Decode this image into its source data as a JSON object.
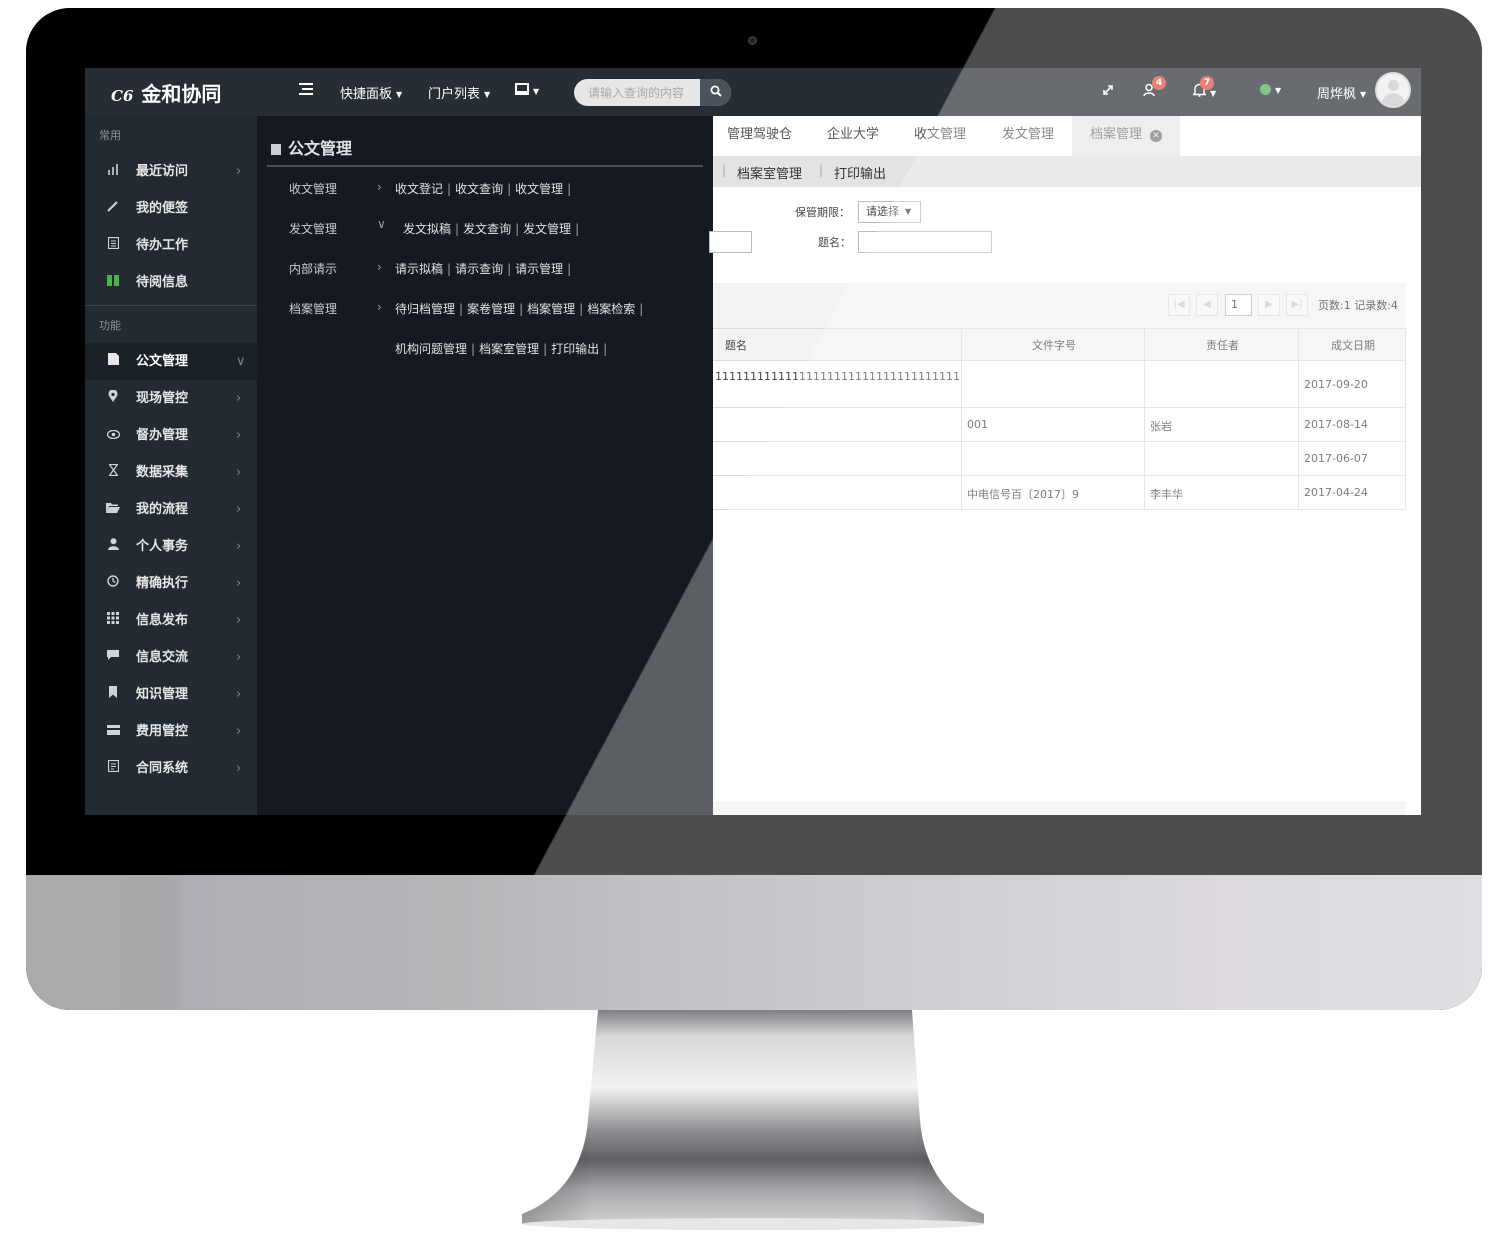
{
  "topbar": {
    "logo_mark": "C6",
    "logo_text": "金和协同",
    "menu_icon": "menu-lines-icon",
    "quick_panel": "快捷面板",
    "portal_list": "门户列表",
    "desktop_icon": "monitor-icon",
    "search": {
      "placeholder": "请输入查询的内容"
    },
    "user_badge": "4",
    "bell_badge": "7",
    "status_color": "#4caf50",
    "user_name": "周烨枫"
  },
  "sidebar": {
    "section_common": "常用",
    "common_items": [
      {
        "label": "最近访问",
        "icon": "bar-chart-icon"
      },
      {
        "label": "我的便签",
        "icon": "pencil-icon"
      },
      {
        "label": "待办工作",
        "icon": "document-icon"
      },
      {
        "label": "待阅信息",
        "icon": "columns-icon"
      }
    ],
    "section_function": "功能",
    "function_items": [
      {
        "label": "公文管理",
        "icon": "file-icon"
      },
      {
        "label": "现场管控",
        "icon": "map-pin-icon"
      },
      {
        "label": "督办管理",
        "icon": "eye-icon"
      },
      {
        "label": "数据采集",
        "icon": "hourglass-icon"
      },
      {
        "label": "我的流程",
        "icon": "folder-open-icon"
      },
      {
        "label": "个人事务",
        "icon": "user-icon"
      },
      {
        "label": "精确执行",
        "icon": "clock-icon"
      },
      {
        "label": "信息发布",
        "icon": "grid-icon"
      },
      {
        "label": "信息交流",
        "icon": "chat-icon"
      },
      {
        "label": "知识管理",
        "icon": "bookmark-icon"
      },
      {
        "label": "费用管控",
        "icon": "card-icon"
      },
      {
        "label": "合同系统",
        "icon": "contract-icon"
      }
    ]
  },
  "mega": {
    "title": "公文管理",
    "rows": [
      {
        "category": "收文管理",
        "links": [
          "收文登记",
          "收文查询",
          "收文管理"
        ]
      },
      {
        "category": "发文管理",
        "links": [
          "发文拟稿",
          "发文查询",
          "发文管理"
        ]
      },
      {
        "category": "内部请示",
        "links": [
          "请示拟稿",
          "请示查询",
          "请示管理"
        ]
      },
      {
        "category": "档案管理",
        "links": [
          "待归档管理",
          "案卷管理",
          "档案管理",
          "档案检索"
        ]
      },
      {
        "category": "",
        "links": [
          "机构问题管理",
          "档案室管理",
          "打印输出"
        ]
      }
    ]
  },
  "tabs": [
    "管理驾驶仓",
    "企业大学",
    "收文管理",
    "发文管理",
    "档案管理"
  ],
  "subtabs": [
    "档案室管理",
    "打印输出"
  ],
  "form": {
    "retention_label": "保管期限：",
    "retention_value": "请选择",
    "title_label": "题名："
  },
  "pager": {
    "page": "1",
    "info": "页数:1 记录数:4"
  },
  "grid": {
    "columns": [
      "题名",
      "文件字号",
      "责任者",
      "成文日期"
    ],
    "rows": [
      {
        "title": "111111111111111111111111111111111111111111111",
        "doc_no": "",
        "owner": "",
        "date": "2017-09-20"
      },
      {
        "title": "",
        "doc_no": "001",
        "owner": "张岩",
        "date": "2017-08-14"
      },
      {
        "title": "",
        "doc_no": "",
        "owner": "",
        "date": "2017-06-07"
      },
      {
        "title": "",
        "doc_no": "中电信号百〔2017〕9",
        "owner": "李丰华",
        "date": "2017-04-24"
      }
    ]
  }
}
